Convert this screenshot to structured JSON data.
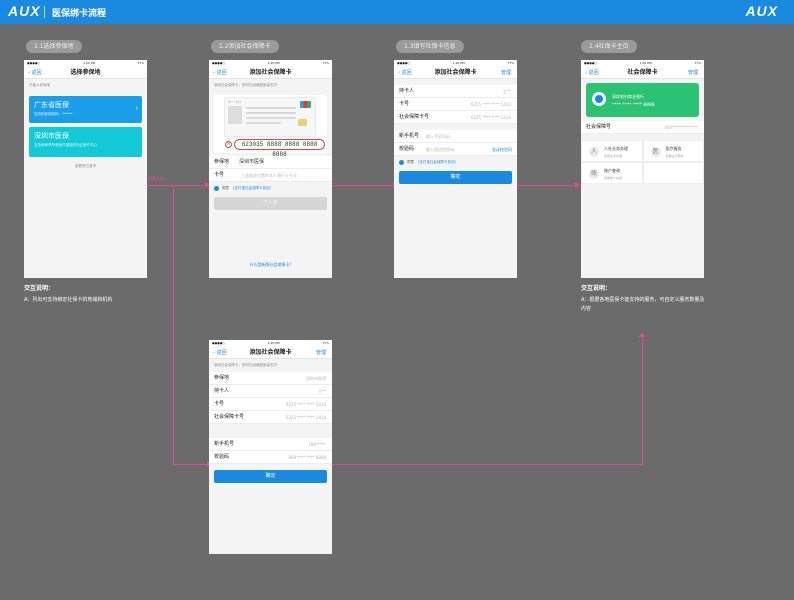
{
  "header": {
    "logo": "AUX",
    "title": "医保绑卡流程"
  },
  "status_bar": {
    "time": "1:20 PM",
    "battery": "77%"
  },
  "flow_label": "查看选择",
  "steps": [
    {
      "label": "1.1选择参保地"
    },
    {
      "label": "1.2添加社会保障卡"
    },
    {
      "label": "1.3填写社保卡信息"
    },
    {
      "label": "1.4社保卡主页"
    }
  ],
  "screen1": {
    "back": "返回",
    "title": "选择参保地",
    "hint": "已接入参保地",
    "areas": [
      {
        "name": "广东省医保",
        "desc": "支持的参保机构：******"
      },
      {
        "name": "深圳市医保",
        "desc": "支持深圳市所有医疗保险的社区医疗中心"
      }
    ],
    "more": "查看其它省市"
  },
  "screen2": {
    "back": "返回",
    "title": "添加社会保障卡",
    "hint": "添加社会保障卡，即可在线缴费医保支付",
    "card_header": "中 一卡行",
    "card_number": "623035 8888 8888 8888 8888",
    "rows": [
      {
        "label": "参保地",
        "value": "深圳市医保"
      },
      {
        "label": "卡号",
        "placeholder": "上面描述位置的本人银行卡卡号"
      }
    ],
    "agree": "同意",
    "agree_link": "《支付宝社会保障卡协议》",
    "next": "下一步",
    "faq": "什么是新版社会保障卡?"
  },
  "screen3": {
    "back": "返回",
    "title": "添加社会保障卡",
    "manage": "管理",
    "rows": [
      {
        "label": "持卡人",
        "value": "王**"
      },
      {
        "label": "卡号",
        "value": "6225 **** **** 1414"
      },
      {
        "label": "社会保障卡号",
        "value": "6225 **** **** 1414"
      }
    ],
    "phone_label": "新手机号",
    "phone_placeholder": "输入手机号码",
    "code_label": "校验码",
    "code_placeholder": "输入短信校验码",
    "code_button": "发送校验码",
    "agree": "同意",
    "agree_link": "《支付宝社会保障卡协议》",
    "confirm": "确定"
  },
  "screen4": {
    "back": "返回",
    "title": "社会保障卡",
    "manage": "管理",
    "bank": "深圳农村商业银行",
    "card_no": "****  ****  ****  8888",
    "si_label": "社会保障号",
    "si_value": "440*************",
    "services": [
      {
        "title": "人社业务办理",
        "sub": "查看业务办理",
        "icon": "人"
      },
      {
        "title": "医疗服务",
        "sub": "查看医疗服务",
        "icon": "医"
      },
      {
        "title": "账户查询",
        "sub": "查看账户余额",
        "icon": "账"
      }
    ]
  },
  "screen5": {
    "back": "返回",
    "title": "添加社会保障卡",
    "manage": "管理",
    "hint": "添加社会保障卡，即可在线缴费医保支付",
    "rows": [
      {
        "label": "参保地",
        "value": "深圳市医保"
      },
      {
        "label": "持卡人",
        "value": "王**"
      },
      {
        "label": "卡号",
        "value": "6225 **** **** 1414"
      },
      {
        "label": "社会保障卡号",
        "value": "6225 **** **** 1414"
      }
    ],
    "phone_label": "新手机号",
    "phone_value": "186*****",
    "code_label": "校验码",
    "code_value": "888 **** **** 8888",
    "confirm": "确定"
  },
  "notes": {
    "left": {
      "title": "交互说明：",
      "body": "A：列出可支持绑定社保卡的地域和机构"
    },
    "right": {
      "title": "交互说明：",
      "body": "A：根据各地医保卡能支持的服务，可自定义服务数量及内容"
    }
  },
  "colors": {
    "accent": "#1a8ae0",
    "connector": "#e04a9d",
    "social_card": "#2cc274"
  }
}
